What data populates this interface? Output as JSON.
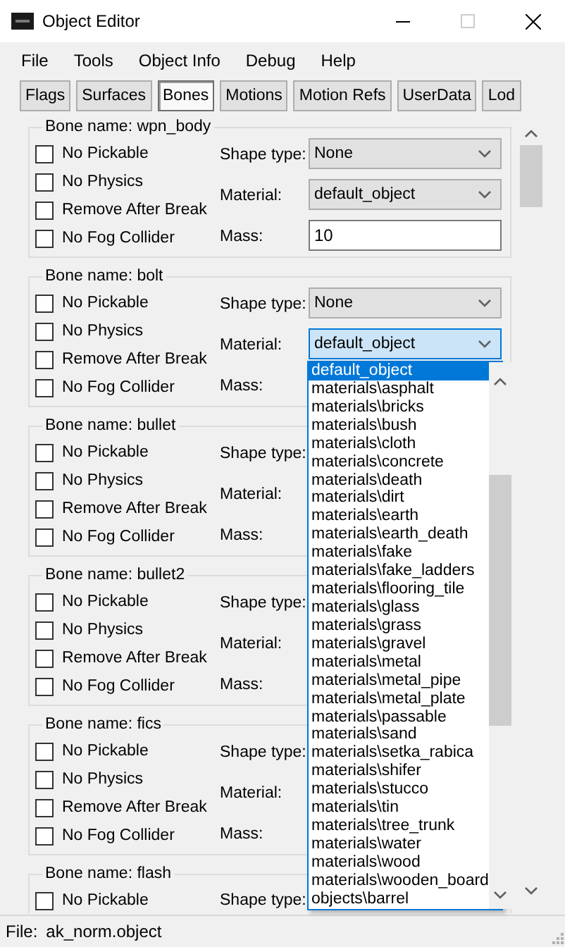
{
  "window": {
    "title": "Object Editor"
  },
  "menu": [
    "File",
    "Tools",
    "Object Info",
    "Debug",
    "Help"
  ],
  "tabs": [
    {
      "label": "Flags",
      "selected": false
    },
    {
      "label": "Surfaces",
      "selected": false
    },
    {
      "label": "Bones",
      "selected": true
    },
    {
      "label": "Motions",
      "selected": false
    },
    {
      "label": "Motion Refs",
      "selected": false
    },
    {
      "label": "UserData",
      "selected": false
    },
    {
      "label": "Lod",
      "selected": false
    }
  ],
  "bones": [
    {
      "title": "Bone name: wpn_body",
      "flags": [
        {
          "label": "No Pickable",
          "checked": false
        },
        {
          "label": "No Physics",
          "checked": false
        },
        {
          "label": "Remove After Break",
          "checked": false
        },
        {
          "label": "No Fog Collider",
          "checked": false
        }
      ],
      "fields": [
        {
          "label": "Shape type:",
          "kind": "select",
          "value": "None"
        },
        {
          "label": "Material:",
          "kind": "select",
          "value": "default_object"
        },
        {
          "label": "Mass:",
          "kind": "input",
          "value": "10"
        }
      ]
    },
    {
      "title": "Bone name: bolt",
      "flags": [
        {
          "label": "No Pickable",
          "checked": false
        },
        {
          "label": "No Physics",
          "checked": false
        },
        {
          "label": "Remove After Break",
          "checked": false
        },
        {
          "label": "No Fog Collider",
          "checked": false
        }
      ],
      "fields": [
        {
          "label": "Shape type:",
          "kind": "select",
          "value": "None"
        },
        {
          "label": "Material:",
          "kind": "select",
          "value": "default_object",
          "open": true
        },
        {
          "label": "Mass:"
        }
      ]
    },
    {
      "title": "Bone name: bullet",
      "flags": [
        {
          "label": "No Pickable",
          "checked": false
        },
        {
          "label": "No Physics",
          "checked": false
        },
        {
          "label": "Remove After Break",
          "checked": false
        },
        {
          "label": "No Fog Collider",
          "checked": false
        }
      ],
      "fields": [
        {
          "label": "Shape type:"
        },
        {
          "label": "Material:"
        },
        {
          "label": "Mass:"
        }
      ]
    },
    {
      "title": "Bone name: bullet2",
      "flags": [
        {
          "label": "No Pickable",
          "checked": false
        },
        {
          "label": "No Physics",
          "checked": false
        },
        {
          "label": "Remove After Break",
          "checked": false
        },
        {
          "label": "No Fog Collider",
          "checked": false
        }
      ],
      "fields": [
        {
          "label": "Shape type:"
        },
        {
          "label": "Material:"
        },
        {
          "label": "Mass:"
        }
      ]
    },
    {
      "title": "Bone name: fics",
      "flags": [
        {
          "label": "No Pickable",
          "checked": false
        },
        {
          "label": "No Physics",
          "checked": false
        },
        {
          "label": "Remove After Break",
          "checked": false
        },
        {
          "label": "No Fog Collider",
          "checked": false
        }
      ],
      "fields": [
        {
          "label": "Shape type:"
        },
        {
          "label": "Material:"
        },
        {
          "label": "Mass:"
        }
      ]
    },
    {
      "title": "Bone name: flash",
      "flags": [
        {
          "label": "No Pickable",
          "checked": false
        }
      ],
      "fields": [
        {
          "label": "Shape type:"
        }
      ]
    }
  ],
  "dropdown_list": [
    {
      "label": "default_object",
      "selected": true
    },
    {
      "label": "materials\\asphalt",
      "selected": false
    },
    {
      "label": "materials\\bricks",
      "selected": false
    },
    {
      "label": "materials\\bush",
      "selected": false
    },
    {
      "label": "materials\\cloth",
      "selected": false
    },
    {
      "label": "materials\\concrete",
      "selected": false
    },
    {
      "label": "materials\\death",
      "selected": false
    },
    {
      "label": "materials\\dirt",
      "selected": false
    },
    {
      "label": "materials\\earth",
      "selected": false
    },
    {
      "label": "materials\\earth_death",
      "selected": false
    },
    {
      "label": "materials\\fake",
      "selected": false
    },
    {
      "label": "materials\\fake_ladders",
      "selected": false
    },
    {
      "label": "materials\\flooring_tile",
      "selected": false
    },
    {
      "label": "materials\\glass",
      "selected": false
    },
    {
      "label": "materials\\grass",
      "selected": false
    },
    {
      "label": "materials\\gravel",
      "selected": false
    },
    {
      "label": "materials\\metal",
      "selected": false
    },
    {
      "label": "materials\\metal_pipe",
      "selected": false
    },
    {
      "label": "materials\\metal_plate",
      "selected": false
    },
    {
      "label": "materials\\passable",
      "selected": false
    },
    {
      "label": "materials\\sand",
      "selected": false
    },
    {
      "label": "materials\\setka_rabica",
      "selected": false
    },
    {
      "label": "materials\\shifer",
      "selected": false
    },
    {
      "label": "materials\\stucco",
      "selected": false
    },
    {
      "label": "materials\\tin",
      "selected": false
    },
    {
      "label": "materials\\tree_trunk",
      "selected": false
    },
    {
      "label": "materials\\water",
      "selected": false
    },
    {
      "label": "materials\\wood",
      "selected": false
    },
    {
      "label": "materials\\wooden_board",
      "selected": false
    },
    {
      "label": "objects\\barrel",
      "selected": false
    }
  ],
  "status_bar": {
    "label": "File:",
    "value": "ak_norm.object"
  }
}
